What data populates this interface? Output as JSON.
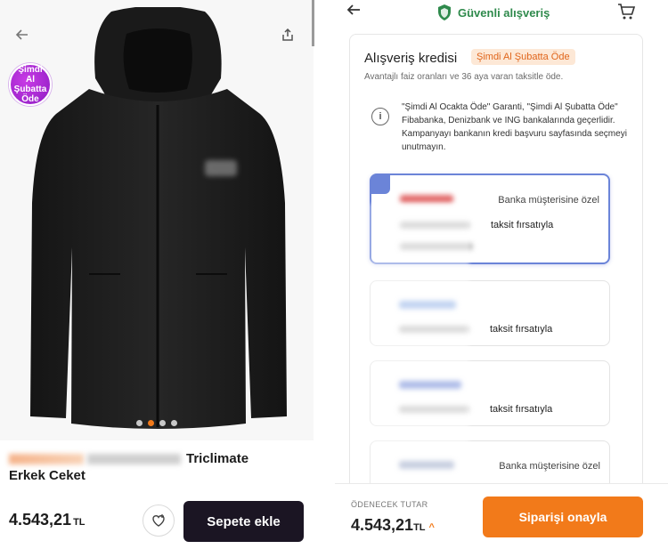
{
  "left": {
    "promo_badge": "Şimdi Al Şubatta Öde",
    "product_title": "Triclimate",
    "product_title_line2": "Erkek Ceket",
    "carousel": {
      "count": 4,
      "active_index": 2
    },
    "price": "4.543,21",
    "currency": "TL",
    "add_to_cart_label": "Sepete ekle",
    "colors": {
      "accent": "#f27a1a",
      "cart_button": "#1b1523"
    }
  },
  "right": {
    "header": {
      "secure_label": "Güvenli alışveriş"
    },
    "credit": {
      "title": "Alışveriş kredisi",
      "badge": "Şimdi Al Şubatta Öde",
      "subtitle": "Avantajlı faiz oranları ve 36 aya varan taksitle öde.",
      "info": "\"Şimdi Al Ocakta Öde\" Garanti, \"Şimdi Al Şubatta Öde\" Fibabanka, Denizbank ve ING bankalarında geçerlidir. Kampanyayı bankanın kredi başvuru sayfasında seçmeyi unutmayın."
    },
    "banks": [
      {
        "tag": "Banka müşterisine özel",
        "offer": "taksit fırsatıyla",
        "selected": true
      },
      {
        "tag": "",
        "offer": "taksit fırsatıyla",
        "selected": false
      },
      {
        "tag": "",
        "offer": "taksit fırsatıyla",
        "selected": false
      },
      {
        "tag": "Banka müşterisine özel",
        "offer": "",
        "selected": false
      }
    ],
    "footer": {
      "pay_label": "ÖDENECEK TUTAR",
      "amount": "4.543,21",
      "currency": "TL",
      "confirm_label": "Siparişi onayla"
    },
    "colors": {
      "secure_green": "#2f8a4c",
      "selected_border": "#6b84d8"
    }
  }
}
